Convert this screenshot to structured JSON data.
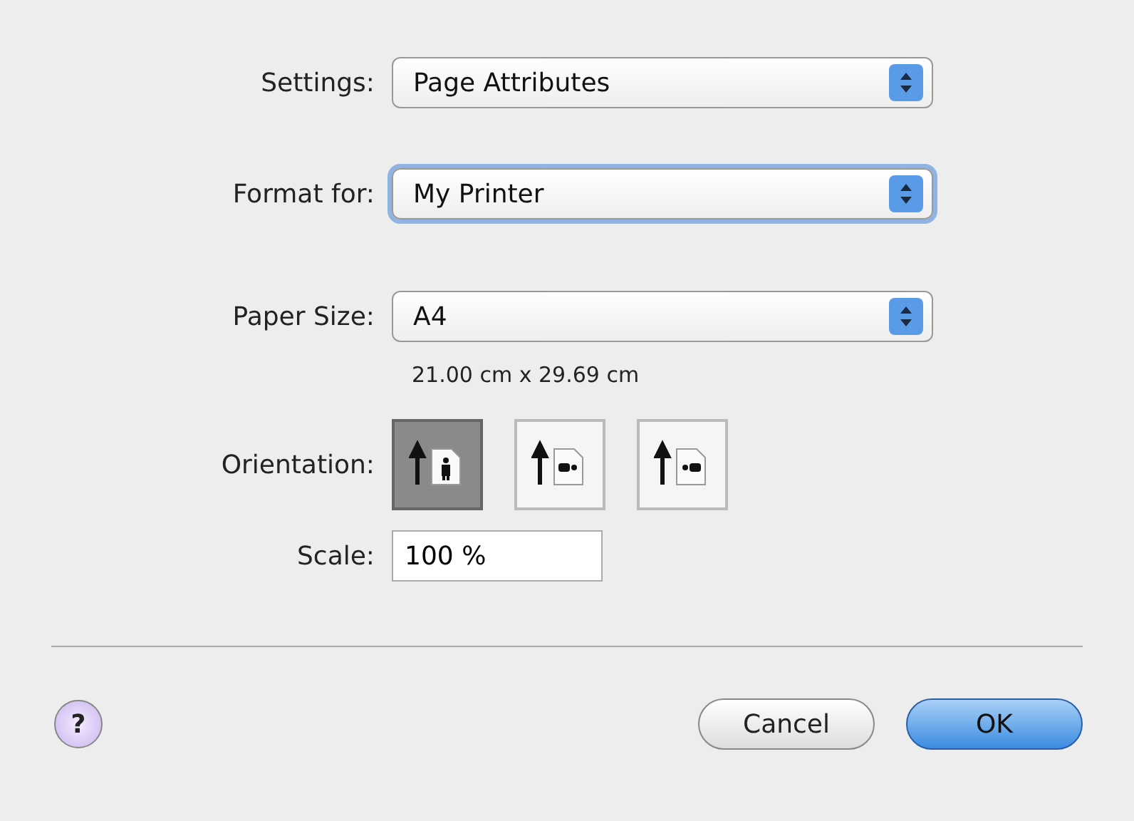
{
  "popups": [
    {
      "label": "Settings:",
      "value": "Page Attributes",
      "focused": false
    },
    {
      "label": "Format for:",
      "value": "My Printer",
      "focused": true
    },
    {
      "label": "Paper Size:",
      "value": "A4",
      "focused": false
    }
  ],
  "paper_dimensions": "21.00 cm x 29.69 cm",
  "orientation": {
    "label": "Orientation:",
    "options": [
      {
        "kind": "portrait",
        "selected": true
      },
      {
        "kind": "landscape",
        "selected": false
      },
      {
        "kind": "reverse-landscape",
        "selected": false
      }
    ]
  },
  "scale": {
    "label": "Scale:",
    "value": "100 %"
  },
  "help": {
    "symbol": "?"
  },
  "buttons": [
    {
      "label": "Cancel",
      "kind": "secondary"
    },
    {
      "label": "OK",
      "kind": "default"
    }
  ]
}
